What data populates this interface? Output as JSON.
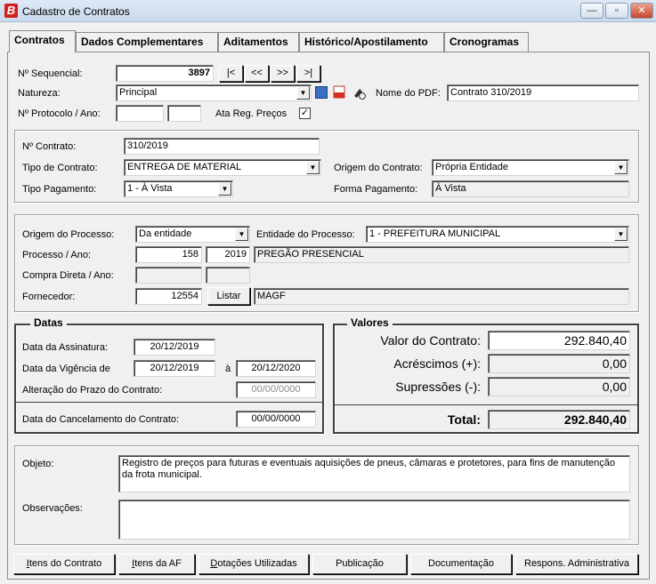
{
  "window": {
    "title": "Cadastro de Contratos",
    "icon_letter": "B",
    "min": "—",
    "max": "▫",
    "close": "✕"
  },
  "tabs": [
    "Contratos",
    "Dados Complementares",
    "Aditamentos",
    "Histórico/Apostilamento",
    "Cronogramas"
  ],
  "header": {
    "seq_label": "Nº Sequencial:",
    "seq_value": "3897",
    "nav": [
      "|<",
      "<<",
      ">>",
      ">|"
    ],
    "natureza_label": "Natureza:",
    "natureza_value": "Principal",
    "pdf_label": "Nome do PDF:",
    "pdf_value": "Contrato 310/2019",
    "protocolo_label": "Nº Protocolo / Ano:",
    "protocolo_num": "",
    "protocolo_ano": "",
    "ata_label": "Ata Reg. Preços",
    "ata_checked": "✓"
  },
  "contrato": {
    "numero_label": "Nº Contrato:",
    "numero_value": "310/2019",
    "tipo_label": "Tipo de Contrato:",
    "tipo_value": "ENTREGA DE MATERIAL",
    "origem_label": "Origem do Contrato:",
    "origem_value": "Própria Entidade",
    "pagamento_label": "Tipo Pagamento:",
    "pagamento_value": "1 - À Vista",
    "forma_label": "Forma Pagamento:",
    "forma_value": "À Vista"
  },
  "processo": {
    "origem_label": "Origem do Processo:",
    "origem_value": "Da entidade",
    "entidade_label": "Entidade do Processo:",
    "entidade_value": "1 - PREFEITURA MUNICIPAL",
    "proc_label": "Processo / Ano:",
    "proc_num": "158",
    "proc_ano": "2019",
    "proc_desc": "PREGÃO PRESENCIAL",
    "compra_label": "Compra Direta / Ano:",
    "compra_num": "",
    "compra_ano": "",
    "fornecedor_label": "Fornecedor:",
    "fornecedor_code": "12554",
    "listar": "Listar",
    "fornecedor_nome": "MAGF"
  },
  "datas": {
    "legend": "Datas",
    "assinatura_label": "Data da Assinatura:",
    "assinatura": "20/12/2019",
    "vigencia_label": "Data da Vigência de",
    "vigencia_ini": "20/12/2019",
    "a": "à",
    "vigencia_fim": "20/12/2020",
    "alteracao_label": "Alteração do Prazo do Contrato:",
    "alteracao": "00/00/0000",
    "cancel_label": "Data do Cancelamento do Contrato:",
    "cancel": "00/00/0000"
  },
  "valores": {
    "legend": "Valores",
    "valor_label": "Valor do Contrato:",
    "valor": "292.840,40",
    "acresc_label": "Acréscimos (+):",
    "acresc": "0,00",
    "supress_label": "Supressões (-):",
    "supress": "0,00",
    "total_label": "Total:",
    "total": "292.840,40"
  },
  "texto": {
    "objeto_label": "Objeto:",
    "objeto": "Registro de preços para futuras e eventuais aquisições de pneus, câmaras e protetores, para fins de manutenção da frota municipal.",
    "obs_label": "Observações:",
    "obs": ""
  },
  "footer_buttons": [
    "Itens do Contrato",
    "Itens da AF",
    "Dotações Utilizadas",
    "Publicação",
    "Documentação",
    "Respons. Administrativa"
  ]
}
